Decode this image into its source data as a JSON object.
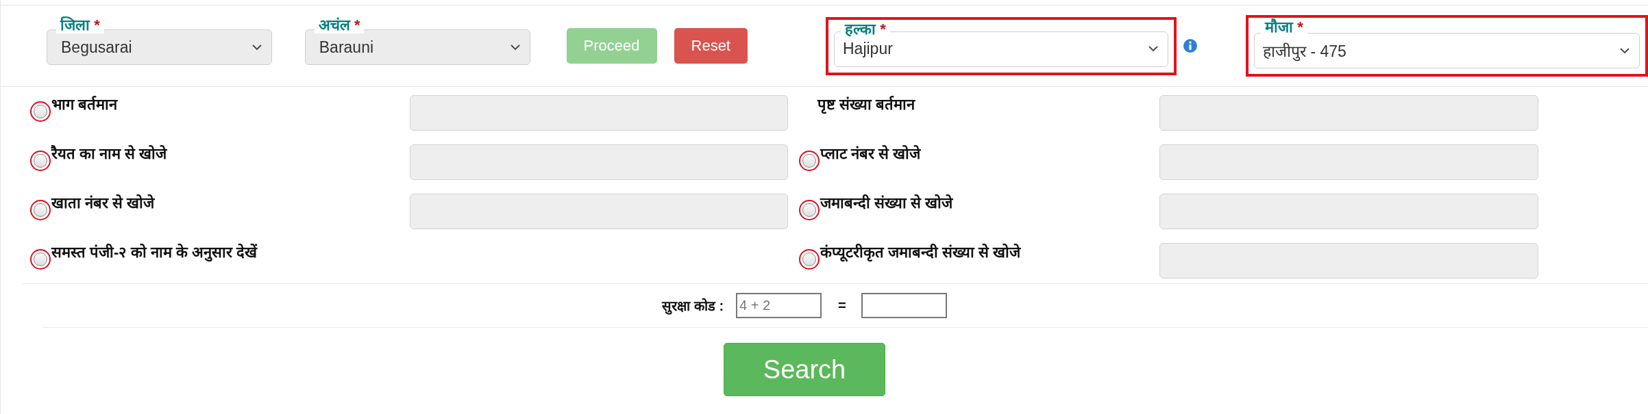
{
  "filters": [
    {
      "label": "जिला",
      "required_mark": "*",
      "value": "Begusarai"
    },
    {
      "label": "अचंल",
      "required_mark": "*",
      "value": "Barauni"
    }
  ],
  "buttons": [
    {
      "label": "Proceed",
      "kind": "proceed",
      "disabled": true
    },
    {
      "label": "Reset",
      "kind": "reset",
      "disabled": false
    }
  ],
  "filters_right": [
    {
      "label": "हल्का",
      "required_mark": "*",
      "value": "Hajipur",
      "highlighted": true,
      "info": true
    },
    {
      "label": "मौजा",
      "required_mark": "*",
      "value": "हाजीपुर - 475",
      "highlighted": true,
      "info": false
    }
  ],
  "search_options": [
    {
      "kind": "radio",
      "label": "भाग बर्तमान",
      "selected": false,
      "highlighted": true,
      "has_field": true
    },
    {
      "kind": "label",
      "label": "पृष्ट संख्या बर्तमान",
      "has_field": true
    },
    {
      "kind": "radio",
      "label": "रैयत का नाम से खोजे",
      "selected": false,
      "highlighted": true,
      "has_field": true
    },
    {
      "kind": "radio",
      "label": "प्लाट नंबर से खोजे",
      "selected": false,
      "highlighted": true,
      "has_field": true
    },
    {
      "kind": "radio",
      "label": "खाता नंबर से खोजे",
      "selected": false,
      "highlighted": true,
      "has_field": true
    },
    {
      "kind": "radio",
      "label": "जमाबन्दी संख्या से खोजे",
      "selected": false,
      "highlighted": true,
      "has_field": true
    },
    {
      "kind": "radio",
      "label": "समस्त पंजी-२ को नाम के अनुसार देखें",
      "selected": false,
      "highlighted": true,
      "has_field": false
    },
    {
      "kind": "radio",
      "label": "कंप्यूटरीकृत जमाबन्दी संख्या से खोजे",
      "selected": false,
      "highlighted": true,
      "has_field": true
    }
  ],
  "security_code": {
    "label": "सुरक्षा कोड :",
    "question": "4 + 2",
    "equals": "="
  },
  "search_button": "Search"
}
